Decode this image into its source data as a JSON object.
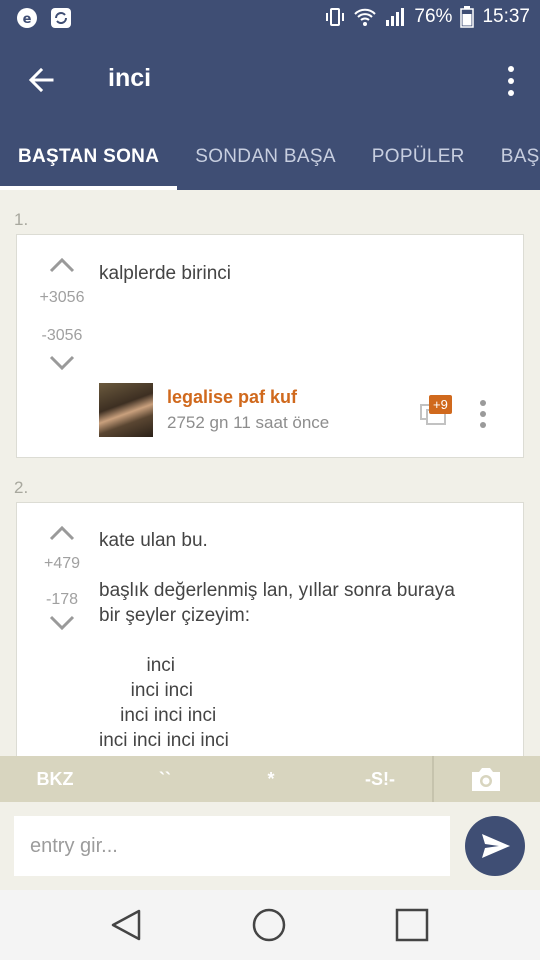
{
  "status_bar": {
    "battery": "76%",
    "time": "15:37"
  },
  "appbar": {
    "title": "inci"
  },
  "tabs": [
    {
      "label": "BAŞTAN SONA",
      "active": true
    },
    {
      "label": "SONDAN BAŞA",
      "active": false
    },
    {
      "label": "POPÜLER",
      "active": false
    },
    {
      "label": "BAŞ",
      "active": false
    }
  ],
  "entries": [
    {
      "number": "1.",
      "upvotes": "+3056",
      "downvotes": "-3056",
      "text": "kalplerde birinci",
      "author": "legalise paf kuf",
      "meta": "2752 gn 11 saat  önce",
      "comment_badge": "+9"
    },
    {
      "number": "2.",
      "upvotes": "+479",
      "downvotes": "-178",
      "text": "kate ulan bu.\n\nbaşlık değerlenmiş lan, yıllar sonra buraya\nbir şeyler çizeyim:\n\n         inci\n      inci inci\n    inci inci inci\ninci inci inci inci"
    }
  ],
  "toolbar": {
    "bkz": "BKZ",
    "backtick": "``",
    "star": "*",
    "spoiler": "-S!-"
  },
  "input": {
    "placeholder": "entry gir..."
  },
  "colors": {
    "primary": "#3f4e74",
    "accent": "#d0691d",
    "background": "#f1f0e8",
    "toolbar": "#d8d5bf"
  },
  "icons": [
    "back-arrow-icon",
    "overflow-menu-icon",
    "upvote-icon",
    "downvote-icon",
    "comment-icon",
    "camera-icon",
    "send-icon",
    "nav-back-icon",
    "nav-home-icon",
    "nav-recents-icon"
  ]
}
